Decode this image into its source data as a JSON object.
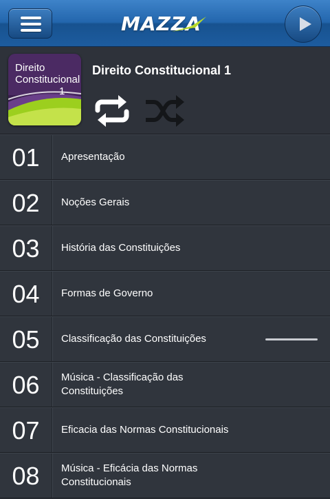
{
  "topbar": {
    "logo_text": "MAZZA",
    "menu_icon": "hamburger-menu-icon",
    "play_icon": "play-icon"
  },
  "album": {
    "cover_lines": [
      "Direito",
      "Constitucional",
      "1"
    ],
    "title": "Direito Constitucional 1",
    "repeat_icon": "repeat-icon",
    "shuffle_icon": "shuffle-icon"
  },
  "tracks": [
    {
      "number": "01",
      "title": "Apresentação"
    },
    {
      "number": "02",
      "title": "Noções Gerais"
    },
    {
      "number": "03",
      "title": "História das Constituições"
    },
    {
      "number": "04",
      "title": "Formas de Governo"
    },
    {
      "number": "05",
      "title": "Classificação das Constituições"
    },
    {
      "number": "06",
      "title": "Música - Classificação das Constituições"
    },
    {
      "number": "07",
      "title": "Eficacia das Normas Constitucionais"
    },
    {
      "number": "08",
      "title": "Música - Eficácia das Normas Constitucionais"
    }
  ],
  "colors": {
    "topbar": "#2366ad",
    "row_background": "#30353d",
    "accent_green": "#9ccf1e"
  }
}
